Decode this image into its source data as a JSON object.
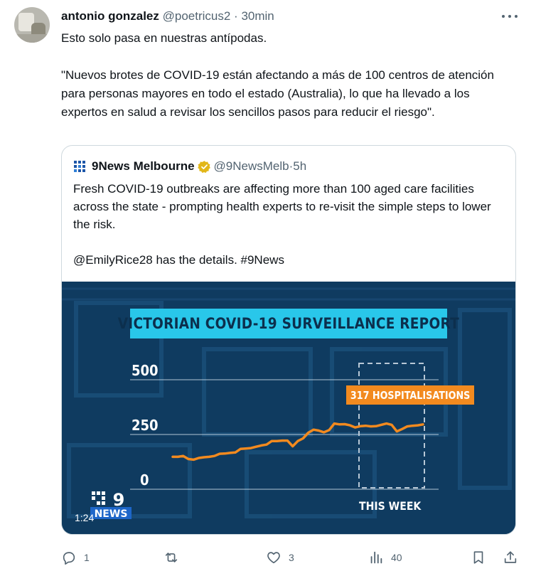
{
  "tweet": {
    "author_name": "antonio gonzalez",
    "handle": "@poetricus2",
    "separator": " · ",
    "time": "30min",
    "text": "Esto solo pasa en nuestras antípodas.\n\n\"Nuevos brotes de COVID-19 están afectando a más de 100 centros de atención para personas mayores en todo el estado (Australia), lo que ha llevado a los expertos en salud a revisar los sencillos pasos para reducir el riesgo\"."
  },
  "quoted_tweet": {
    "author_name": "9News Melbourne",
    "handle": "@9NewsMelb",
    "separator": " · ",
    "time": "5h",
    "text": "Fresh COVID-19 outbreaks are affecting more than 100 aged care facilities across the state - prompting health experts to re-visit the simple steps to lower the risk.\n\n@EmilyRice28 has the details. #9News",
    "video": {
      "duration": "1:24",
      "title": "VICTORIAN COVID-19 SURVEILLANCE REPORT",
      "y_ticks": [
        "500",
        "250",
        "0"
      ],
      "callout": "317 HOSPITALISATIONS",
      "highlight_label": "THIS WEEK",
      "logo_text": "NEWS",
      "line_color": "#f28a1f",
      "accent_color": "#29c7ea",
      "chart_series": [
        148,
        148,
        152,
        138,
        135,
        143,
        146,
        148,
        152,
        162,
        163,
        166,
        168,
        184,
        186,
        188,
        194,
        200,
        204,
        220,
        220,
        222,
        222,
        196,
        220,
        232,
        258,
        272,
        268,
        260,
        270,
        300,
        296,
        297,
        292,
        282,
        288,
        290,
        287,
        288,
        294,
        300,
        294,
        264,
        275,
        287,
        290,
        292,
        296
      ]
    }
  },
  "actions": {
    "reply_count": "1",
    "retweet_count": "",
    "like_count": "3",
    "view_count": "40"
  },
  "colors": {
    "text": "#0f1419",
    "muted": "#536471",
    "border": "#cfd9de",
    "verified_gold": "#e2b719"
  }
}
